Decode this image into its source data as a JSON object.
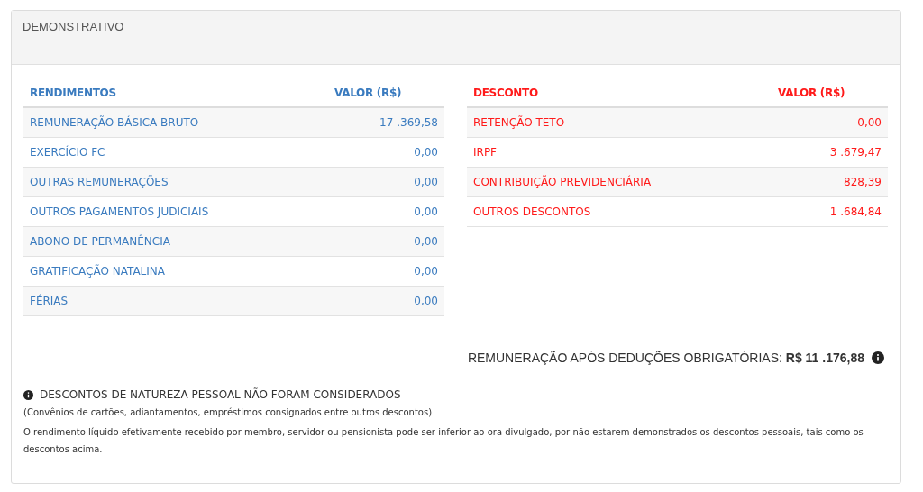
{
  "panel": {
    "title": "DEMONSTRATIVO"
  },
  "tables": [
    {
      "kind": "income",
      "columns": [
        "RENDIMENTOS",
        "VALOR (R$)"
      ],
      "rows": [
        {
          "label": "REMUNERAÇÃO BÁSICA BRUTO",
          "value": "17 .369,58"
        },
        {
          "label": "EXERCÍCIO FC",
          "value": "0,00"
        },
        {
          "label": "OUTRAS REMUNERAÇÕES",
          "value": "0,00"
        },
        {
          "label": "OUTROS PAGAMENTOS JUDICIAIS",
          "value": "0,00"
        },
        {
          "label": "ABONO DE PERMANÊNCIA",
          "value": "0,00"
        },
        {
          "label": "GRATIFICAÇÃO NATALINA",
          "value": "0,00"
        },
        {
          "label": "FÉRIAS",
          "value": "0,00"
        }
      ]
    },
    {
      "kind": "discount",
      "columns": [
        "DESCONTO",
        "VALOR (R$)"
      ],
      "rows": [
        {
          "label": "RETENÇÃO TETO",
          "value": "0,00"
        },
        {
          "label": "IRPF",
          "value": "3 .679,47"
        },
        {
          "label": "CONTRIBUIÇÃO PREVIDENCIÁRIA",
          "value": "828,39"
        },
        {
          "label": "OUTROS DESCONTOS",
          "value": "1 .684,84"
        }
      ]
    }
  ],
  "total": "REMUNERAÇÃO APÓS DEDUÇÕES OBRIGATÓRIAS: **R$ 11 .176,88**",
  "notice": {
    "title": "DESCONTOS DE NATUREZA PESSOAL NÃO FORAM CONSIDERADOS",
    "lines": [
      "(Convênios de cartões, adiantamentos, empréstimos consignados entre outros descontos)",
      "O rendimento líquido efetivamente recebido por membro, servidor ou pensionista pode ser inferior ao ora divulgado, por não estarem demonstrados os descontos pessoais, tais como os descontos acima."
    ]
  }
}
